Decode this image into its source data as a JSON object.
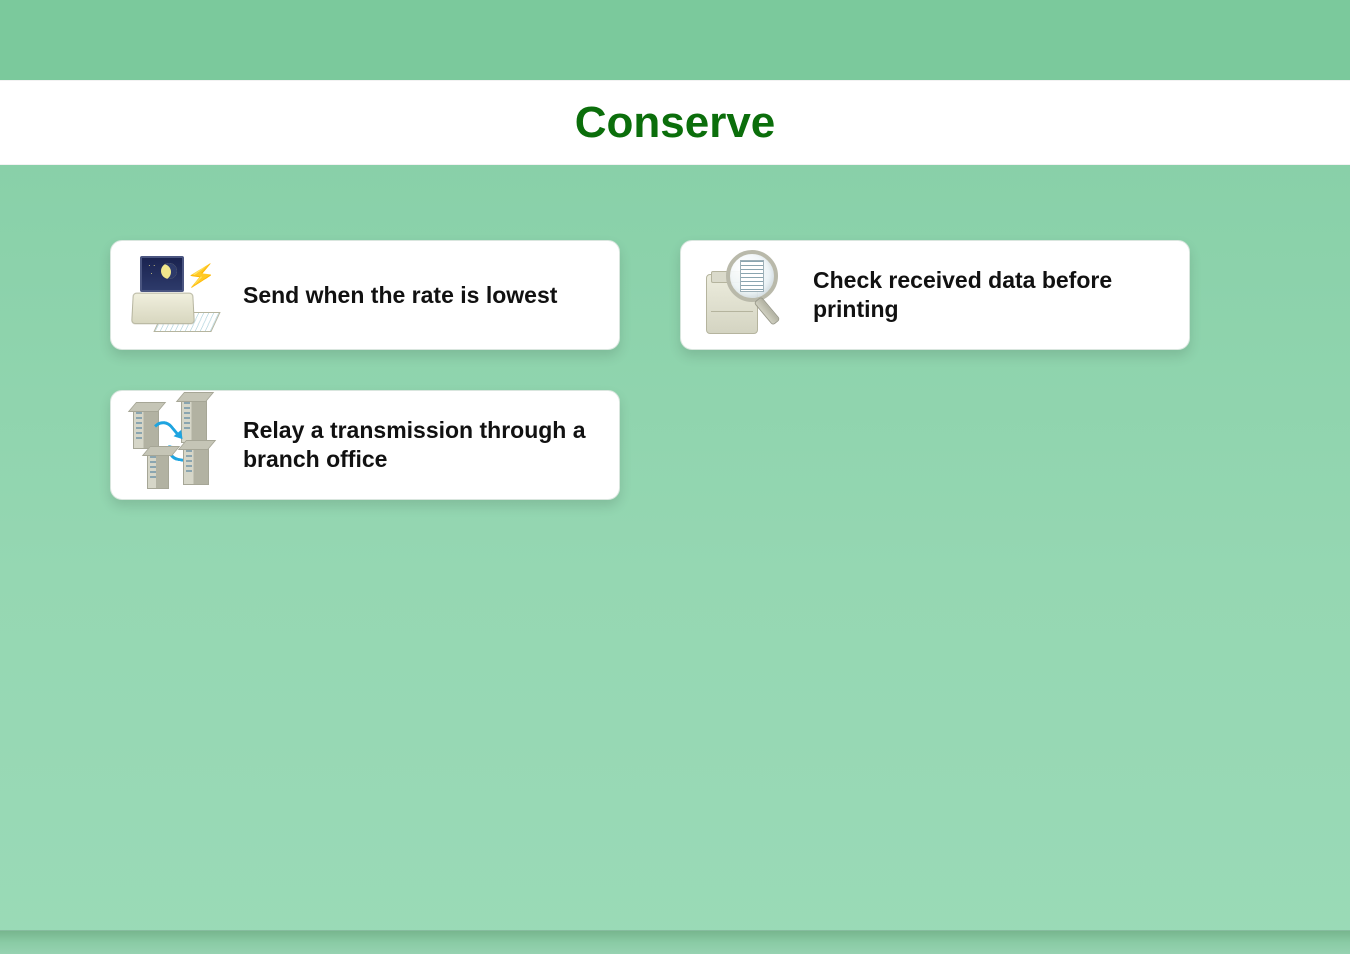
{
  "title": "Conserve",
  "colors": {
    "title_text": "#0b6e0b",
    "background_top": "#7bc99c",
    "background_bottom": "#9adab7",
    "card_bg": "#ffffff"
  },
  "cards": {
    "left": [
      {
        "label": "Send when the rate is lowest",
        "icon": "night-fax-icon"
      },
      {
        "label": "Relay a transmission through a branch office",
        "icon": "buildings-relay-icon"
      }
    ],
    "right": [
      {
        "label": "Check received data before printing",
        "icon": "printer-magnify-icon"
      }
    ]
  }
}
